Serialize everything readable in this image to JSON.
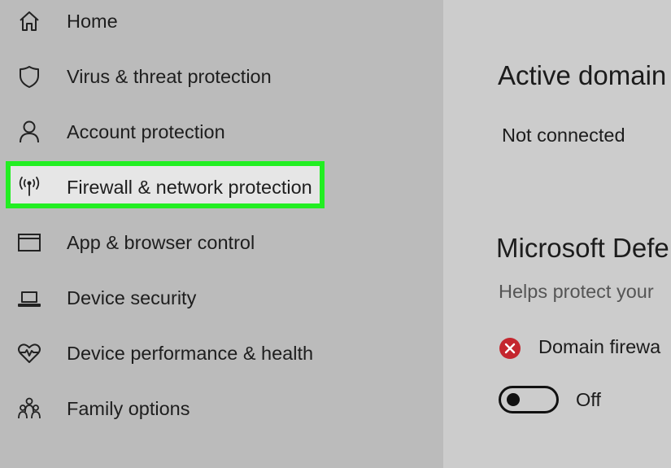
{
  "sidebar": {
    "items": [
      {
        "label": "Home",
        "icon": "home-icon"
      },
      {
        "label": "Virus & threat protection",
        "icon": "shield-icon"
      },
      {
        "label": "Account protection",
        "icon": "person-icon"
      },
      {
        "label": "Firewall & network protection",
        "icon": "antenna-icon",
        "highlighted": true
      },
      {
        "label": "App & browser control",
        "icon": "browser-window-icon"
      },
      {
        "label": "Device security",
        "icon": "laptop-icon"
      },
      {
        "label": "Device performance & health",
        "icon": "heart-pulse-icon"
      },
      {
        "label": "Family options",
        "icon": "family-icon"
      }
    ]
  },
  "main": {
    "active_domain_title": "Active domain",
    "active_domain_status": "Not connected",
    "defender_title": "Microsoft Defe",
    "defender_description": "Helps protect your",
    "domain_firewall_label": "Domain firewa",
    "toggle_state_label": "Off"
  },
  "colors": {
    "highlight_border": "#22ee22",
    "error_icon": "#c4262e",
    "sidebar_bg": "#bbbbbb",
    "main_bg": "#cccccc"
  }
}
